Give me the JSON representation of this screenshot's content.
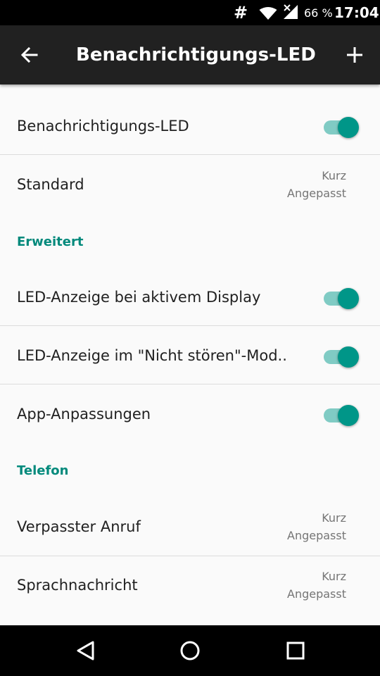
{
  "status_bar": {
    "hash_symbol": "#",
    "wifi_icon": "wifi-icon",
    "signal_icon": "signal-no-data-icon",
    "battery_text": "66 %",
    "time": "17:04"
  },
  "toolbar": {
    "back_icon": "arrow-back-icon",
    "title": "Benachrichtigungs-LED",
    "add_icon": "plus-icon"
  },
  "settings": {
    "led_toggle": {
      "title": "Benachrichtigungs-LED",
      "enabled": true
    },
    "standard": {
      "title": "Standard",
      "summary_line1": "Kurz",
      "summary_line2": "Angepasst"
    },
    "section_advanced": "Erweitert",
    "led_active_display": {
      "title": "LED-Anzeige bei aktivem Display",
      "enabled": true
    },
    "led_dnd": {
      "title": "LED-Anzeige im \"Nicht stören\"-Mod..",
      "enabled": true
    },
    "app_customizations": {
      "title": "App-Anpassungen",
      "enabled": true
    },
    "section_phone": "Telefon",
    "missed_call": {
      "title": "Verpasster Anruf",
      "summary_line1": "Kurz",
      "summary_line2": "Angepasst"
    },
    "voicemail": {
      "title": "Sprachnachricht",
      "summary_line1": "Kurz",
      "summary_line2": "Angepasst"
    }
  },
  "colors": {
    "accent": "#009688",
    "accent_track": "#80cbc4",
    "section_header": "#00897b",
    "toolbar_bg": "#212121"
  },
  "nav_bar": {
    "back_icon": "nav-back-triangle-icon",
    "home_icon": "nav-home-circle-icon",
    "recent_icon": "nav-recents-square-icon"
  }
}
